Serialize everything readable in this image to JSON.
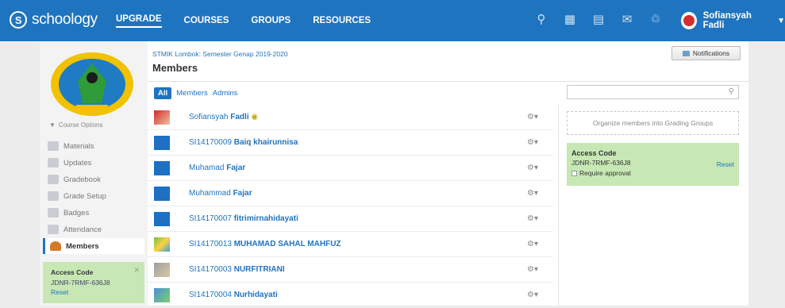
{
  "topbar": {
    "brand": "schoology",
    "nav": [
      "UPGRADE",
      "COURSES",
      "GROUPS",
      "RESOURCES"
    ],
    "user_name": "Sofiansyah Fadli"
  },
  "sidebar": {
    "course_options": "Course Options",
    "items": [
      "Materials",
      "Updates",
      "Gradebook",
      "Grade Setup",
      "Badges",
      "Attendance",
      "Members"
    ],
    "access_code": {
      "title": "Access Code",
      "code": "JDNR-7RMF-636J8",
      "reset": "Reset"
    }
  },
  "header": {
    "breadcrumb": "STMIK Lombok: Semester Genap 2019-2020",
    "title": "Members",
    "notifications": "Notifications"
  },
  "filters": [
    "All",
    "Members",
    "Admins"
  ],
  "members": [
    {
      "prefix": "Sofiansyah ",
      "name": "Fadli"
    },
    {
      "prefix": "SI14170009 ",
      "name": "Baiq khairunnisa"
    },
    {
      "prefix": "Muhamad ",
      "name": "Fajar"
    },
    {
      "prefix": "Muhammad ",
      "name": "Fajar"
    },
    {
      "prefix": "SI14170007 ",
      "name": "fitrimirnahidayati"
    },
    {
      "prefix": "SI14170013 ",
      "name": "MUHAMAD SAHAL MAHFUZ"
    },
    {
      "prefix": "SI14170003 ",
      "name": "NURFITRIANI"
    },
    {
      "prefix": "SI14170004 ",
      "name": "Nurhidayati"
    }
  ],
  "right": {
    "grading_groups": "Organize members into Grading Groups",
    "access_code": {
      "title": "Access Code",
      "code": "JDNR-7RMF-636J8",
      "reset": "Reset",
      "require": "Require approval"
    }
  }
}
